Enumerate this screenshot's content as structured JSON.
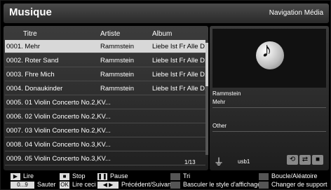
{
  "header": {
    "title": "Musique",
    "subtitle": "Navigation Média"
  },
  "list": {
    "columns": {
      "title": "Titre",
      "artist": "Artiste",
      "album": "Album"
    },
    "rows": [
      {
        "title": "0001. Mehr",
        "artist": "Rammstein",
        "album": "Liebe Ist Fr Alle D..."
      },
      {
        "title": "0002. Roter Sand",
        "artist": "Rammstein",
        "album": "Liebe Ist Fr Alle D..."
      },
      {
        "title": "0003. Fhre Mich",
        "artist": "Rammstein",
        "album": "Liebe Ist Fr Alle D..."
      },
      {
        "title": "0004. Donaukinder",
        "artist": "Rammstein",
        "album": "Liebe Ist Fr Alle D..."
      },
      {
        "title": "0005. 01 Violin Concerto No.2,KV...",
        "artist": "",
        "album": ""
      },
      {
        "title": "0006. 02 Violin Concerto No.2,KV...",
        "artist": "",
        "album": ""
      },
      {
        "title": "0007. 03 Violin Concerto No.2,KV...",
        "artist": "",
        "album": ""
      },
      {
        "title": "0008. 04 Violin Concerto No.3,KV...",
        "artist": "",
        "album": ""
      },
      {
        "title": "0009. 05 Violin Concerto No.3,KV...",
        "artist": "",
        "album": ""
      }
    ],
    "selected_index": 0,
    "page_indicator": "1/13"
  },
  "info": {
    "artist": "Rammstein",
    "track": "Mehr",
    "genre": "Other",
    "device": "usb1",
    "icons": [
      "usb-icon",
      "repeat-icon",
      "shuffle-icon",
      "stop-icon"
    ]
  },
  "legend": {
    "play_key": "▶",
    "play": "Lire",
    "stop": "Stop",
    "pause": "Pause",
    "sort": "Tri",
    "loop_random": "Boucle/Aléatoire",
    "digits_key": "0...9",
    "jump": "Sauter",
    "ok_key": "OK",
    "play_this": "Lire ceci",
    "prev_next": "Précédent/Suivant",
    "toggle_view": "Basculer le style d'affichage",
    "change_source": "Changer de support"
  }
}
